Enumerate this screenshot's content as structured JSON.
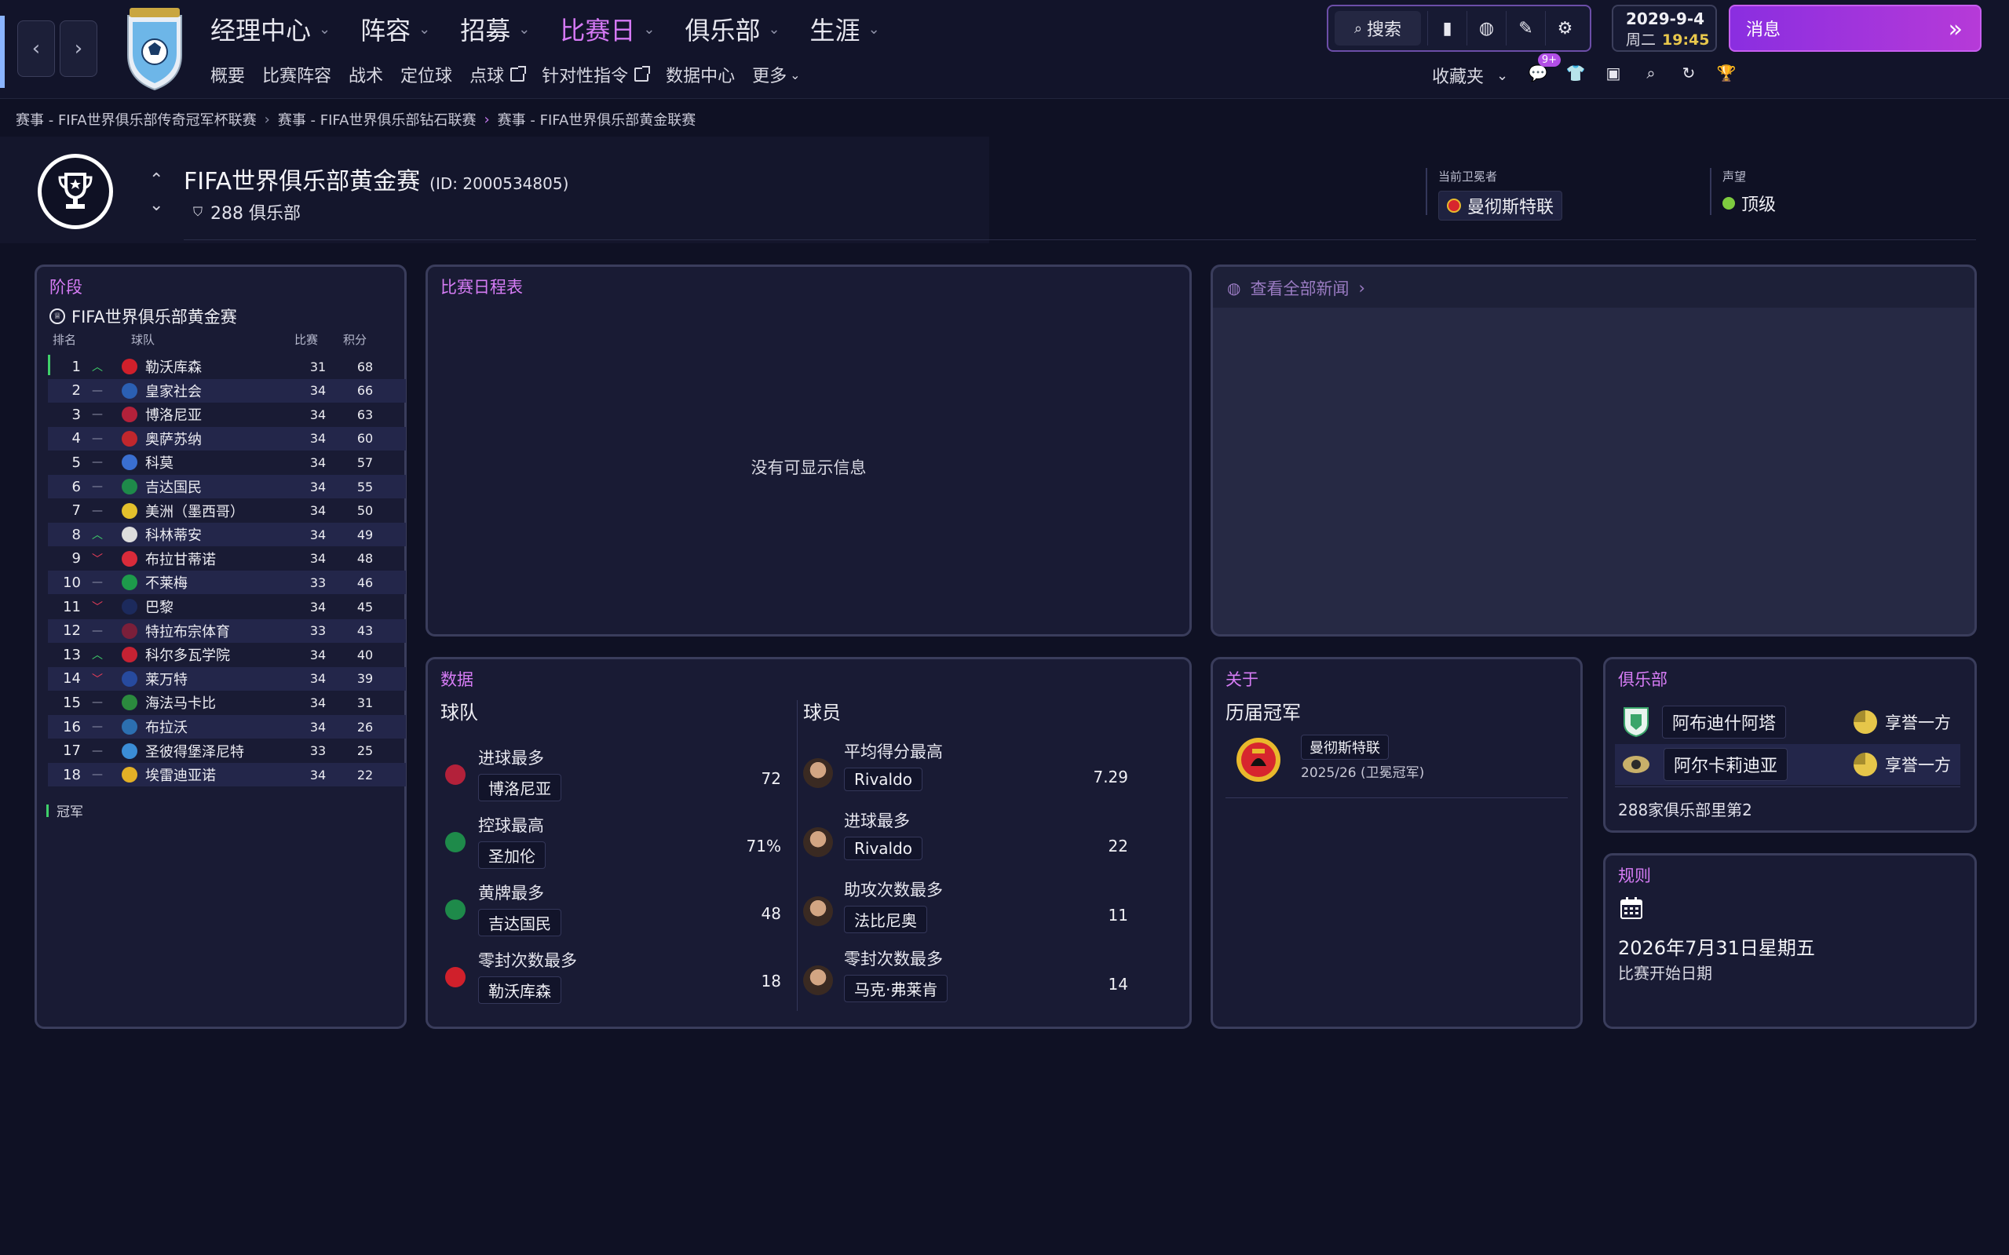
{
  "topnav": {
    "main": [
      "经理中心",
      "阵容",
      "招募",
      "比赛日",
      "俱乐部",
      "生涯"
    ],
    "active_index": 3,
    "sub": [
      "概要",
      "比赛阵容",
      "战术",
      "定位球",
      "点球",
      "针对性指令",
      "数据中心",
      "更多"
    ],
    "search_label": "搜索",
    "date": "2029-9-4",
    "weekday": "周二",
    "time": "19:45",
    "messages_label": "消息",
    "favorites_label": "收藏夹",
    "notification_badge": "9+"
  },
  "breadcrumb": [
    "赛事 - FIFA世界俱乐部传奇冠军杯联赛",
    "赛事 - FIFA世界俱乐部钻石联赛",
    "赛事 - FIFA世界俱乐部黄金联赛"
  ],
  "header": {
    "title": "FIFA世界俱乐部黄金赛",
    "id_text": "(ID: 2000534805)",
    "club_count": "288 俱乐部",
    "holder_label": "当前卫冕者",
    "holder_value": "曼彻斯特联",
    "reputation_label": "声望",
    "reputation_value": "顶级"
  },
  "standings": {
    "panel_title": "阶段",
    "competition": "FIFA世界俱乐部黄金赛",
    "col_rank": "排名",
    "col_team": "球队",
    "col_played": "比赛",
    "col_points": "积分",
    "legend_champion": "冠军",
    "rows": [
      {
        "pos": "1",
        "move": "up",
        "team": "勒沃库森",
        "played": "31",
        "pts": "68",
        "color": "#d0202b"
      },
      {
        "pos": "2",
        "move": "same",
        "team": "皇家社会",
        "played": "34",
        "pts": "66",
        "color": "#2b5fb3"
      },
      {
        "pos": "3",
        "move": "same",
        "team": "博洛尼亚",
        "played": "34",
        "pts": "63",
        "color": "#b3213a"
      },
      {
        "pos": "4",
        "move": "same",
        "team": "奥萨苏纳",
        "played": "34",
        "pts": "60",
        "color": "#c1272d"
      },
      {
        "pos": "5",
        "move": "same",
        "team": "科莫",
        "played": "34",
        "pts": "57",
        "color": "#3a6fd1"
      },
      {
        "pos": "6",
        "move": "same",
        "team": "吉达国民",
        "played": "34",
        "pts": "55",
        "color": "#1e8a4a"
      },
      {
        "pos": "7",
        "move": "same",
        "team": "美洲（墨西哥）",
        "played": "34",
        "pts": "50",
        "color": "#e3c02c"
      },
      {
        "pos": "8",
        "move": "up",
        "team": "科林蒂安",
        "played": "34",
        "pts": "49",
        "color": "#dddddd"
      },
      {
        "pos": "9",
        "move": "down",
        "team": "布拉甘蒂诺",
        "played": "34",
        "pts": "48",
        "color": "#d92b3a"
      },
      {
        "pos": "10",
        "move": "same",
        "team": "不莱梅",
        "played": "33",
        "pts": "46",
        "color": "#1d9a4b"
      },
      {
        "pos": "11",
        "move": "down",
        "team": "巴黎",
        "played": "34",
        "pts": "45",
        "color": "#1c2a5c"
      },
      {
        "pos": "12",
        "move": "same",
        "team": "特拉布宗体育",
        "played": "33",
        "pts": "43",
        "color": "#7b1f3a"
      },
      {
        "pos": "13",
        "move": "up",
        "team": "科尔多瓦学院",
        "played": "34",
        "pts": "40",
        "color": "#c52233"
      },
      {
        "pos": "14",
        "move": "down",
        "team": "莱万特",
        "played": "34",
        "pts": "39",
        "color": "#274a9e"
      },
      {
        "pos": "15",
        "move": "same",
        "team": "海法马卡比",
        "played": "34",
        "pts": "31",
        "color": "#2b8a3e"
      },
      {
        "pos": "16",
        "move": "same",
        "team": "布拉沃",
        "played": "34",
        "pts": "26",
        "color": "#2c6fb0"
      },
      {
        "pos": "17",
        "move": "same",
        "team": "圣彼得堡泽尼特",
        "played": "33",
        "pts": "25",
        "color": "#3b8dd6"
      },
      {
        "pos": "18",
        "move": "same",
        "team": "埃雷迪亚诺",
        "played": "34",
        "pts": "22",
        "color": "#e3b026"
      }
    ]
  },
  "fixtures": {
    "title": "比赛日程表",
    "empty": "没有可显示信息"
  },
  "news": {
    "title": "查看全部新闻"
  },
  "stats": {
    "title": "数据",
    "team_header": "球队",
    "player_header": "球员",
    "team": [
      {
        "label": "进球最多",
        "name": "博洛尼亚",
        "value": "72",
        "color": "#b3213a"
      },
      {
        "label": "控球最高",
        "name": "圣加伦",
        "value": "71%",
        "color": "#1e8a4a"
      },
      {
        "label": "黄牌最多",
        "name": "吉达国民",
        "value": "48",
        "color": "#1e8a4a"
      },
      {
        "label": "零封次数最多",
        "name": "勒沃库森",
        "value": "18",
        "color": "#d0202b"
      }
    ],
    "player": [
      {
        "label": "平均得分最高",
        "name": "Rivaldo",
        "value": "7.29"
      },
      {
        "label": "进球最多",
        "name": "Rivaldo",
        "value": "22"
      },
      {
        "label": "助攻次数最多",
        "name": "法比尼奥",
        "value": "11"
      },
      {
        "label": "零封次数最多",
        "name": "马克·弗莱肯",
        "value": "14"
      }
    ]
  },
  "about": {
    "title": "关于",
    "subtitle": "历届冠军",
    "champion": "曼彻斯特联",
    "season": "2025/26 (卫冕冠军)"
  },
  "clubs": {
    "title": "俱乐部",
    "rows": [
      {
        "name": "阿布迪什阿塔",
        "rep": "享誉一方"
      },
      {
        "name": "阿尔卡莉迪亚",
        "rep": "享誉一方"
      }
    ],
    "footer": "288家俱乐部里第2"
  },
  "rules": {
    "title": "规则",
    "date": "2026年7月31日星期五",
    "caption": "比赛开始日期"
  },
  "colors": {
    "accent": "#d67cf5",
    "background": "#0f1124",
    "panel": "#191b34",
    "up": "#3fd06a",
    "down": "#ef3e5a"
  }
}
